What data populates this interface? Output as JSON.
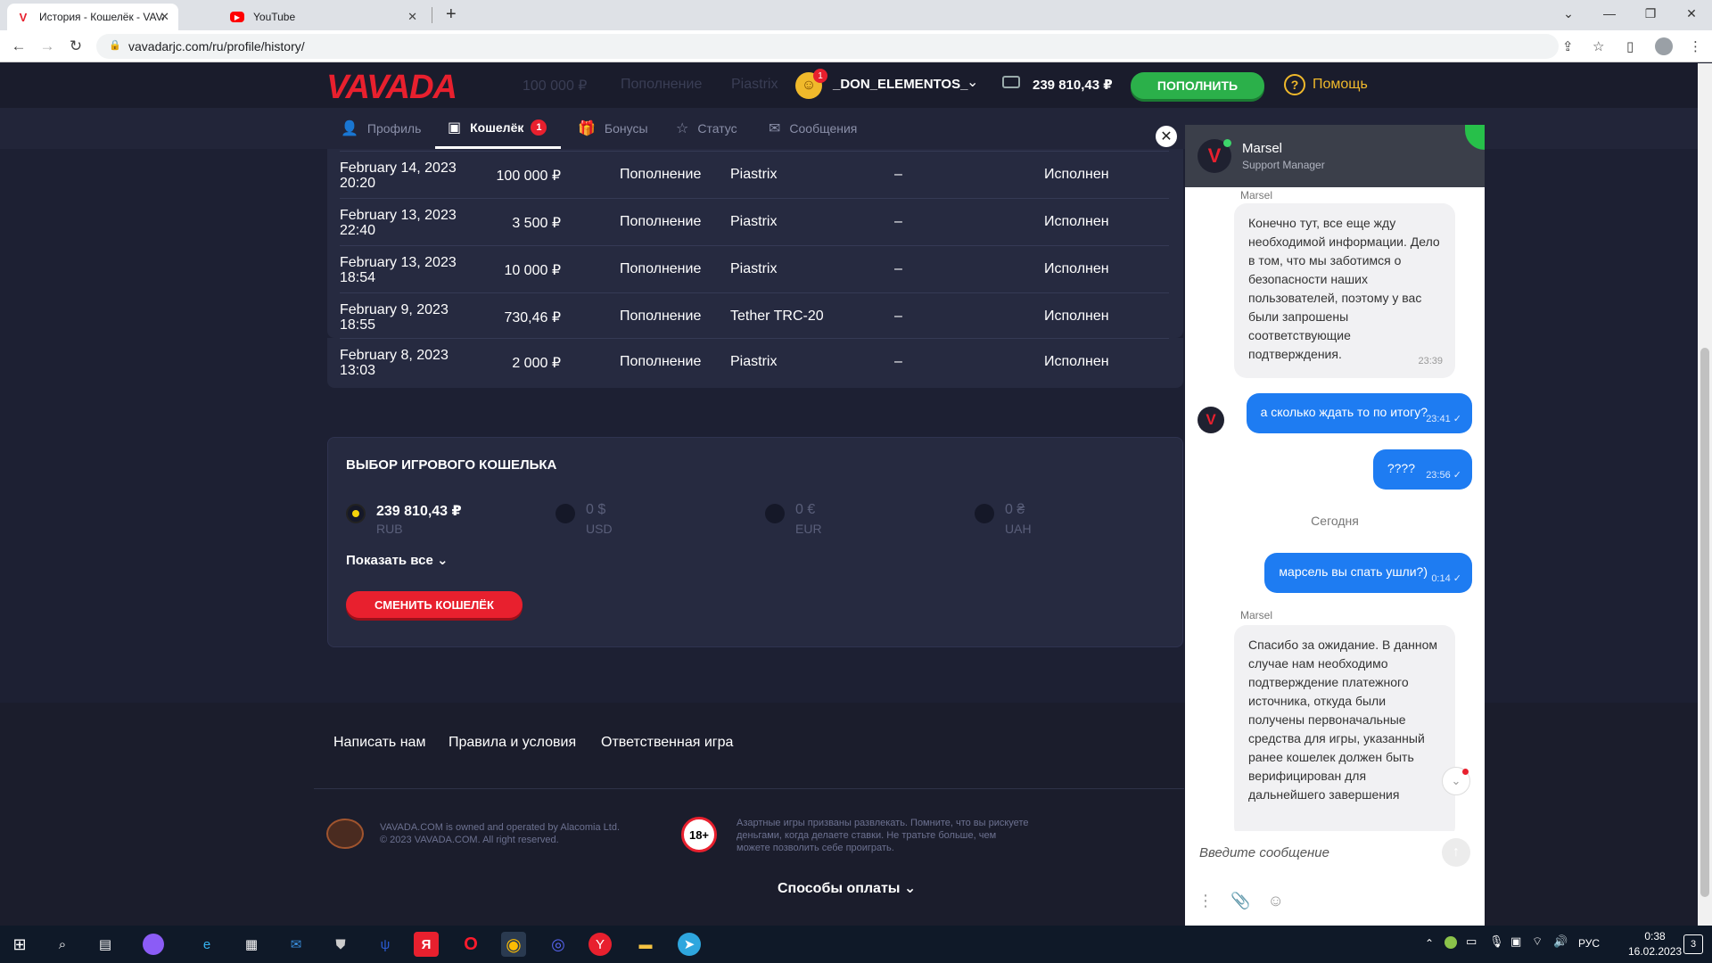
{
  "browser": {
    "tabs": [
      {
        "title": "История - Кошелёк - VAVADA C",
        "favicon": "V"
      },
      {
        "title": "YouTube",
        "favicon": "▶"
      }
    ],
    "url": "vavadarjc.com/ru/profile/history/"
  },
  "header": {
    "logo": "VAVADA",
    "username": "_DON_ELEMENTOS_",
    "avatar_badge": "1",
    "balance": "239 810,43 ₽",
    "deposit_label": "ПОПОЛНИТЬ",
    "help_label": "Помощь",
    "ghost_amount": "100 000 ₽",
    "ghost_type": "Пополнение",
    "ghost_method": "Piastrix"
  },
  "subnav": {
    "items": [
      {
        "label": "Профиль"
      },
      {
        "label": "Кошелёк",
        "badge": "1"
      },
      {
        "label": "Бонусы"
      },
      {
        "label": "Статус"
      },
      {
        "label": "Сообщения"
      }
    ]
  },
  "history": {
    "rows": [
      {
        "date": "February 14, 2023",
        "time": "20:20",
        "amount": "100 000 ₽",
        "type": "Пополнение",
        "method": "Piastrix",
        "extra": "–",
        "status": "Исполнен"
      },
      {
        "date": "February 13, 2023",
        "time": "22:40",
        "amount": "3 500 ₽",
        "type": "Пополнение",
        "method": "Piastrix",
        "extra": "–",
        "status": "Исполнен"
      },
      {
        "date": "February 13, 2023",
        "time": "18:54",
        "amount": "10 000 ₽",
        "type": "Пополнение",
        "method": "Piastrix",
        "extra": "–",
        "status": "Исполнен"
      },
      {
        "date": "February 9, 2023",
        "time": "18:55",
        "amount": "730,46 ₽",
        "type": "Пополнение",
        "method": "Tether TRC-20",
        "extra": "–",
        "status": "Исполнен"
      },
      {
        "date": "February 8, 2023",
        "time": "13:03",
        "amount": "2 000 ₽",
        "type": "Пополнение",
        "method": "Piastrix",
        "extra": "–",
        "status": "Исполнен"
      }
    ]
  },
  "wallet": {
    "title": "ВЫБОР ИГРОВОГО КОШЕЛЬКА",
    "currencies": [
      {
        "amount": "239 810,43 ₽",
        "code": "RUB",
        "selected": true
      },
      {
        "amount": "0 $",
        "code": "USD",
        "selected": false
      },
      {
        "amount": "0 €",
        "code": "EUR",
        "selected": false
      },
      {
        "amount": "0 ₴",
        "code": "UAH",
        "selected": false
      }
    ],
    "show_all": "Показать все",
    "change_button": "СМЕНИТЬ КОШЕЛЁК"
  },
  "footer": {
    "links": [
      "Написать нам",
      "Правила и условия",
      "Ответственная игра"
    ],
    "copyright1": "VAVADA.COM is owned and operated by Alacomia Ltd.",
    "copyright2": "© 2023 VAVADA.COM. All right reserved.",
    "age": "18+",
    "warning": "Азартные игры призваны развлекать. Помните, что вы рискуете деньгами, когда делаете ставки. Не тратьте больше, чем можете позволить себе проиграть.",
    "payment_methods": "Способы оплаты"
  },
  "chat": {
    "agent_name": "Marsel",
    "agent_role": "Support Manager",
    "messages": [
      {
        "sender": "Marsel",
        "text": "Конечно тут, все еще жду необходимой информации. Дело в том, что мы заботимся о безопасности наших пользователей, поэтому у вас были запрошены соответствующие подтверждения.",
        "time": "23:39"
      },
      {
        "text": "а сколько ждать то по итогу?",
        "time": "23:41 ✓"
      },
      {
        "text": "????",
        "time": "23:56 ✓"
      },
      {
        "text": "марсель вы спать ушли?)",
        "time": "0:14 ✓"
      },
      {
        "sender": "Marsel",
        "text": "Спасибо за ожидание. В данном случае нам необходимо подтверждение платежного источника, откуда были получены первоначальные средства для игры, указанный ранее кошелек должен быть верифицирован для дальнейшего завершения"
      }
    ],
    "today_label": "Сегодня",
    "input_placeholder": "Введите сообщение"
  },
  "taskbar": {
    "lang": "РУС",
    "time": "0:38",
    "date": "16.02.2023",
    "notifications": "3"
  },
  "colors": {
    "brand_red": "#e8202e",
    "deposit_green": "#2bb04a",
    "help_yellow": "#f0b92b",
    "chat_blue": "#1e7cf2"
  }
}
